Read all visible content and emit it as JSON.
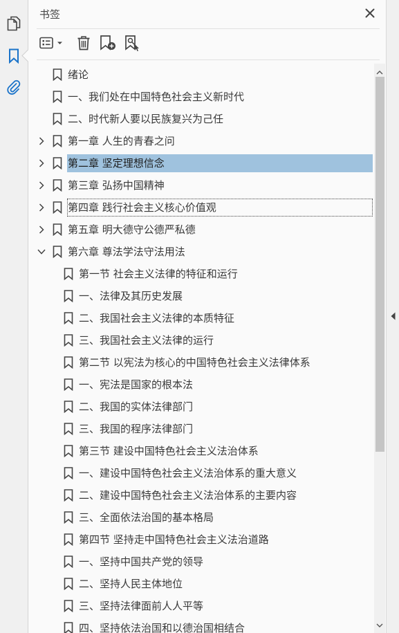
{
  "colors": {
    "accent": "#1a73c9",
    "selection": "#9fc2de",
    "icon_gray": "#444444"
  },
  "rail": {
    "items": [
      {
        "icon": "pages-icon",
        "active": false
      },
      {
        "icon": "bookmark-icon",
        "active": true
      },
      {
        "icon": "attachment-icon",
        "active": false
      }
    ]
  },
  "panel": {
    "title": "书签",
    "close_icon": "close-icon",
    "toolbar": [
      {
        "icon": "options-menu-icon"
      },
      {
        "icon": "delete-icon"
      },
      {
        "icon": "new-bookmark-icon"
      },
      {
        "icon": "bookmark-from-structure-icon"
      }
    ]
  },
  "bookmarks": [
    {
      "label": "绪论",
      "level": 0,
      "twisty": "none"
    },
    {
      "label": "一、我们处在中国特色社会主义新时代",
      "level": 0,
      "twisty": "none"
    },
    {
      "label": "二、时代新人要以民族复兴为己任",
      "level": 0,
      "twisty": "none"
    },
    {
      "label": "第一章  人生的青春之问",
      "level": 0,
      "twisty": "collapsed"
    },
    {
      "label": "第二章  坚定理想信念",
      "level": 0,
      "twisty": "collapsed",
      "selected": true
    },
    {
      "label": "第三章  弘扬中国精神",
      "level": 0,
      "twisty": "collapsed"
    },
    {
      "label": "第四章  践行社会主义核心价值观",
      "level": 0,
      "twisty": "collapsed",
      "focused": true
    },
    {
      "label": "第五章  明大德守公德严私德",
      "level": 0,
      "twisty": "collapsed"
    },
    {
      "label": "第六章  尊法学法守法用法",
      "level": 0,
      "twisty": "expanded"
    },
    {
      "label": "第一节  社会主义法律的特征和运行",
      "level": 1,
      "twisty": "none"
    },
    {
      "label": "一、法律及其历史发展",
      "level": 1,
      "twisty": "none"
    },
    {
      "label": "二、我国社会主义法律的本质特征",
      "level": 1,
      "twisty": "none"
    },
    {
      "label": "三、我国社会主义法律的运行",
      "level": 1,
      "twisty": "none"
    },
    {
      "label": "第二节  以宪法为核心的中国特色社会主义法律体系",
      "level": 1,
      "twisty": "none"
    },
    {
      "label": "一、宪法是国家的根本法",
      "level": 1,
      "twisty": "none"
    },
    {
      "label": "二、我国的实体法律部门",
      "level": 1,
      "twisty": "none"
    },
    {
      "label": "三、我国的程序法律部门",
      "level": 1,
      "twisty": "none"
    },
    {
      "label": "第三节  建设中国特色社会主义法治体系",
      "level": 1,
      "twisty": "none"
    },
    {
      "label": "一、建设中国特色社会主义法治体系的重大意义",
      "level": 1,
      "twisty": "none"
    },
    {
      "label": "二、建设中国特色社会主义法治体系的主要内容",
      "level": 1,
      "twisty": "none"
    },
    {
      "label": "三、全面依法治国的基本格局",
      "level": 1,
      "twisty": "none"
    },
    {
      "label": "第四节  坚持走中国特色社会主义法治道路",
      "level": 1,
      "twisty": "none"
    },
    {
      "label": "一、坚持中国共产党的领导",
      "level": 1,
      "twisty": "none"
    },
    {
      "label": "二、坚持人民主体地位",
      "level": 1,
      "twisty": "none"
    },
    {
      "label": "三、坚持法律面前人人平等",
      "level": 1,
      "twisty": "none"
    },
    {
      "label": "四、坚持依法治国和以德治国相结合",
      "level": 1,
      "twisty": "none"
    }
  ],
  "scrollbar": {
    "up_icon": "scroll-up-icon",
    "down_icon": "scroll-down-icon",
    "position_fraction": 0.0
  },
  "side_handle": {
    "icon": "collapse-panel-icon"
  }
}
